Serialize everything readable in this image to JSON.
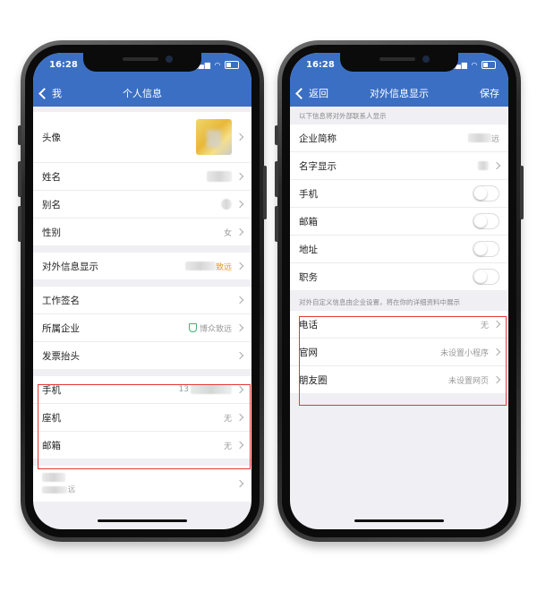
{
  "colors": {
    "header_blue": "#3a6fc4",
    "highlight_red": "#e53935",
    "orange_text": "#e6902d",
    "verified_green": "#3cb371"
  },
  "left_phone": {
    "status_time": "16:28",
    "nav": {
      "back_label": "我",
      "title": "个人信息"
    },
    "avatar": {
      "label": "头像"
    },
    "basic": [
      {
        "label": "姓名"
      },
      {
        "label": "别名"
      },
      {
        "label": "性别",
        "value": "女"
      }
    ],
    "external_display": {
      "label": "对外信息显示",
      "value_suffix": "致远"
    },
    "work": [
      {
        "label": "工作签名"
      },
      {
        "label": "所属企业",
        "value": "博众致远"
      },
      {
        "label": "发票抬头"
      }
    ],
    "contact": [
      {
        "label": "手机",
        "value_prefix": "13"
      },
      {
        "label": "座机",
        "value": "无"
      },
      {
        "label": "邮箱",
        "value": "无"
      }
    ],
    "bottom_item": {
      "sub_suffix": "远"
    }
  },
  "right_phone": {
    "status_time": "16:28",
    "nav": {
      "back_label": "返回",
      "title": "对外信息显示",
      "action_label": "保存"
    },
    "hint_top": "以下信息将对外部联系人显示",
    "company_short": {
      "label": "企业简称",
      "value_suffix": "远"
    },
    "name_display": {
      "label": "名字显示"
    },
    "toggles": [
      {
        "label": "手机",
        "on": false
      },
      {
        "label": "邮箱",
        "on": false
      },
      {
        "label": "地址",
        "on": false
      },
      {
        "label": "职务",
        "on": false
      }
    ],
    "hint_custom": "对外自定义信息由企业设置，将在你的详细资料中展示",
    "custom": [
      {
        "label": "电话",
        "value": "无"
      },
      {
        "label": "官网",
        "value": "未设置小程序"
      },
      {
        "label": "朋友圈",
        "value": "未设置网页"
      }
    ]
  }
}
